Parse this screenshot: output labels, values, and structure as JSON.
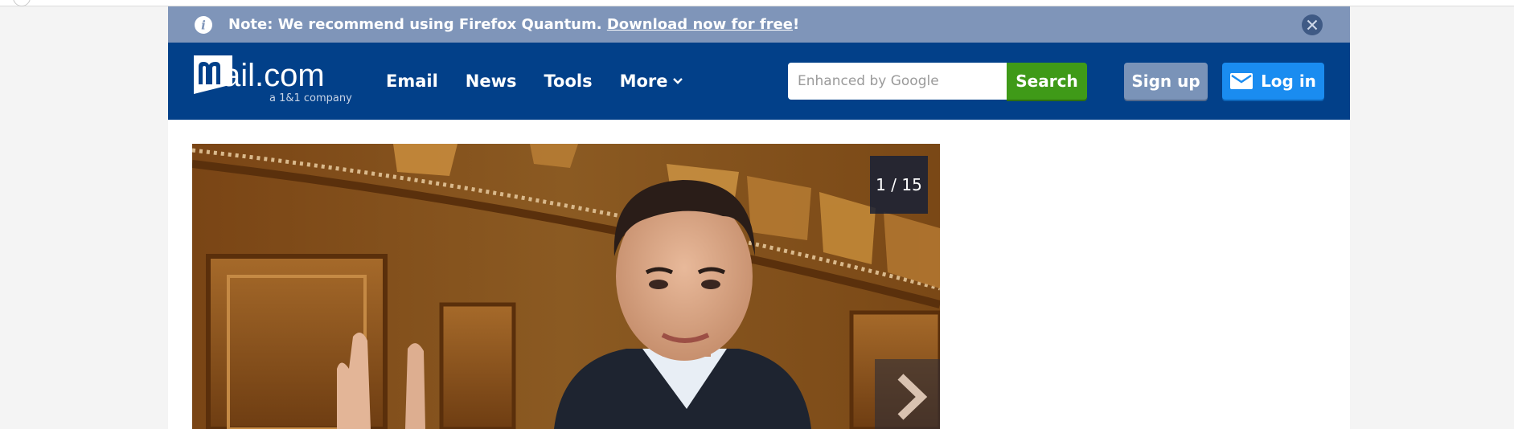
{
  "notice": {
    "prefix": "Note: We recommend using Firefox Quantum. ",
    "link": "Download now for free",
    "suffix": "!"
  },
  "brand": {
    "logo_text": "mail.com",
    "tagline": "a 1&1 company"
  },
  "nav": {
    "items": [
      "Email",
      "News",
      "Tools",
      "More"
    ]
  },
  "search": {
    "placeholder": "Enhanced by Google",
    "button_label": "Search"
  },
  "account": {
    "signup_label": "Sign up",
    "login_label": "Log in"
  },
  "gallery": {
    "counter": "1 / 15"
  },
  "colors": {
    "header_bg": "#024089",
    "notice_bg": "#7f95b9",
    "search_button": "#3f9a18",
    "signup_button": "#7a93b8",
    "login_button": "#1a8cf0"
  },
  "icons": [
    "info-icon",
    "close-icon",
    "chevron-down-icon",
    "envelope-icon",
    "chevron-right-icon"
  ]
}
